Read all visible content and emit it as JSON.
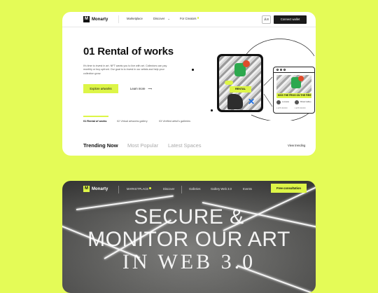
{
  "top_card": {
    "brand": {
      "mark": "M",
      "name": "Monarty"
    },
    "nav": {
      "marketplace": "Marketplace",
      "discover": "Discover",
      "discover_chevron": "⌄",
      "for_creators": "For Creators",
      "user_icon": "♙≡",
      "connect_wallet": "Connect wallet"
    },
    "hero": {
      "title": "01 Rental of works",
      "description": "It's time to invest in art. NFT wants you to live with art. Collectors can pay monthly or buy upfront. Our goal is to invest in our artists and help your collection grow.",
      "explore": "Explore artworks",
      "learn_more": "Learn more",
      "learn_more_arrow": "⟶"
    },
    "hero_tabs": [
      "01 Rental of works",
      "02 Virtual artworks gallery",
      "03 Verified artist's galleries"
    ],
    "art": {
      "rental_button": "RENTAL",
      "banner_title": "KISS THE FROG ON THE FIRST",
      "user1": "Lumasia",
      "user2": "Mitsai Gallery",
      "meta1": "1 ETH 3D ROI",
      "meta2": "1 ETH 3D ROI"
    },
    "trending_tabs": [
      "Trending Now",
      "Most Popular",
      "Latest Spaces"
    ],
    "view_trending": "View trending"
  },
  "bottom_card": {
    "brand": {
      "mark": "M",
      "name": "Monarty"
    },
    "nav": {
      "marketplace": "MARKETPLACE",
      "discover": "Discover",
      "galleries": "Galleries",
      "gallery": "Gallery Web 3.0",
      "events": "Events",
      "consultation": "Free consultation"
    },
    "hero_lines": [
      "SECURE &",
      "MONITOR OUR ART",
      "IN WEB 3.0"
    ]
  },
  "colors": {
    "background": "#E4FB57",
    "accent": "#DDF547",
    "dark": "#1a1a1a"
  }
}
